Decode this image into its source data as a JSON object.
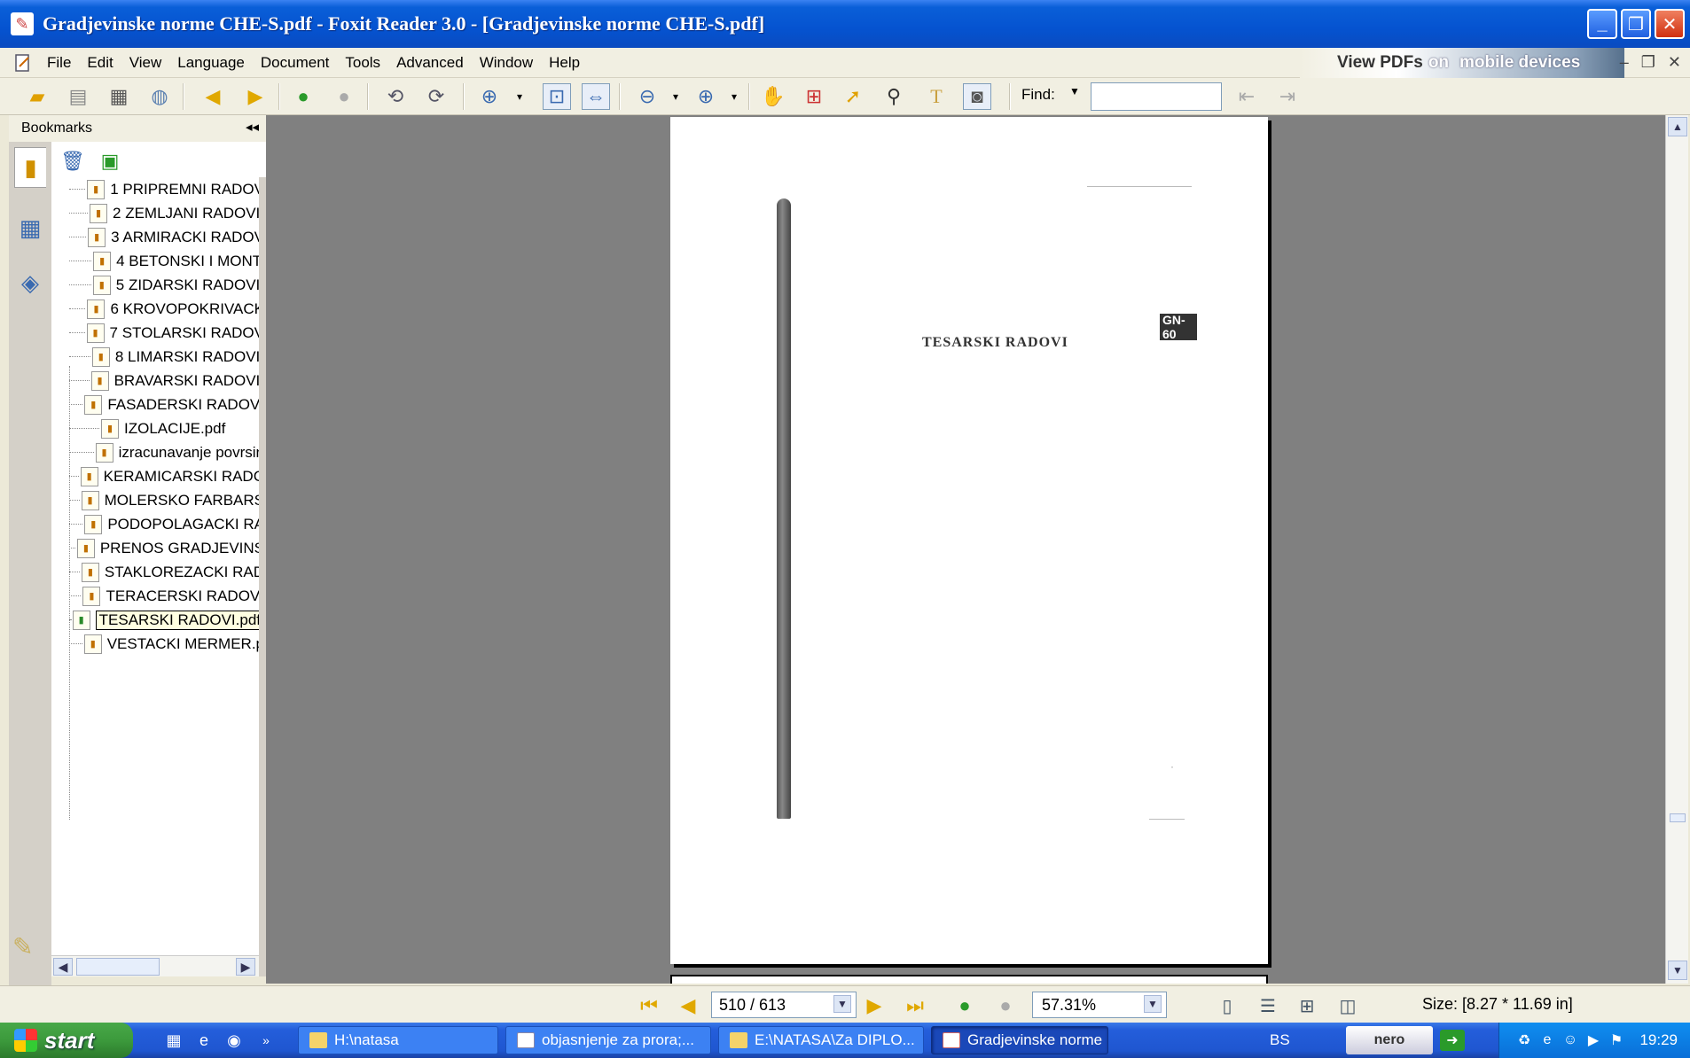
{
  "window": {
    "title": "Gradjevinske norme CHE-S.pdf - Foxit Reader 3.0 - [Gradjevinske norme CHE-S.pdf]",
    "controls": [
      "_",
      "❐",
      "✕"
    ]
  },
  "menu": {
    "items": [
      "File",
      "Edit",
      "View",
      "Language",
      "Document",
      "Tools",
      "Advanced",
      "Window",
      "Help"
    ],
    "promo_prefix": "View PDFs",
    "promo_on": "on",
    "promo_suffix": "mobile devices",
    "mdi_controls": [
      "–",
      "❐",
      "✕"
    ]
  },
  "toolbar": {
    "find_label": "Find:",
    "find_value": ""
  },
  "bookmarks": {
    "header": "Bookmarks",
    "collapse": "◂◂",
    "items": [
      "1 PRIPREMNI RADOV",
      "2 ZEMLJANI RADOVI.",
      "3 ARMIRACKI RADOV",
      "4 BETONSKI I MONT.",
      "5 ZIDARSKI RADOVI.",
      "6 KROVOPOKRIVACK",
      "7 STOLARSKI RADOV",
      "8 LIMARSKI RADOVI.",
      "BRAVARSKI RADOVI.",
      "FASADERSKI RADOVI",
      "IZOLACIJE.pdf",
      "izracunavanje povrsin",
      "KERAMICARSKI RADC",
      "MOLERSKO FARBARS",
      "PODOPOLAGACKI RA",
      "PRENOS GRADJEVINS",
      "STAKLOREZACKI RAD",
      "TERACERSKI RADOVI",
      "TESARSKI RADOVI.pdf",
      "VESTACKI MERMER.p"
    ],
    "selected_index": 18
  },
  "page": {
    "title": "TESARSKI RADOVI",
    "tab_label": "GN-60"
  },
  "status": {
    "page_indicator": "510 / 613",
    "zoom": "57.31%",
    "size": "Size: [8.27 * 11.69 in]"
  },
  "taskbar": {
    "start": "start",
    "tasks": [
      "H:\\natasa",
      "objasnjenje za prora;...",
      "E:\\NATASA\\Za DIPLO...",
      "Gradjevinske norme ..."
    ],
    "language": "BS",
    "nero_label": "nero",
    "clock": "19:29"
  }
}
